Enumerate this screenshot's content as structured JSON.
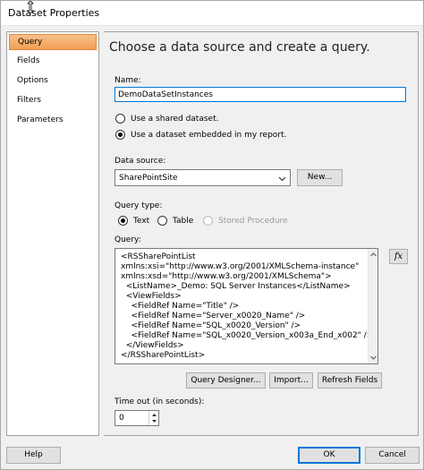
{
  "window": {
    "title": "Dataset Properties"
  },
  "sidebar": {
    "items": [
      {
        "label": "Query"
      },
      {
        "label": "Fields"
      },
      {
        "label": "Options"
      },
      {
        "label": "Filters"
      },
      {
        "label": "Parameters"
      }
    ],
    "selected": "Query"
  },
  "main": {
    "heading": "Choose a data source and create a query.",
    "name_label": "Name:",
    "name_value": "DemoDataSetInstances",
    "dataset_options": [
      {
        "label": "Use a shared dataset.",
        "checked": false
      },
      {
        "label": "Use a dataset embedded in my report.",
        "checked": true
      }
    ],
    "datasource_label": "Data source:",
    "datasource_value": "SharePointSite",
    "new_button": "New...",
    "query_type_label": "Query type:",
    "query_types": [
      {
        "label": "Text",
        "checked": true,
        "disabled": false
      },
      {
        "label": "Table",
        "checked": false,
        "disabled": false
      },
      {
        "label": "Stored Procedure",
        "checked": false,
        "disabled": true
      }
    ],
    "query_label": "Query:",
    "query_lines": [
      "<RSSharePointList",
      "xmlns:xsi=\"http://www.w3.org/2001/XMLSchema-instance\"",
      "xmlns:xsd=\"http://www.w3.org/2001/XMLSchema\">",
      "  <ListName>_Demo: SQL Server Instances</ListName>",
      "  <ViewFields>",
      "    <FieldRef Name=\"Title\" />",
      "    <FieldRef Name=\"Server_x0020_Name\" />",
      "    <FieldRef Name=\"SQL_x0020_Version\" />",
      "    <FieldRef Name=\"SQL_x0020_Version_x003a_End_x002\" />",
      "  </ViewFields>",
      "</RSSharePointList>"
    ],
    "fx_label": "fx",
    "query_designer_button": "Query Designer...",
    "import_button": "Import...",
    "refresh_fields_button": "Refresh Fields",
    "timeout_label": "Time out (in seconds):",
    "timeout_value": "0"
  },
  "footer": {
    "help_button": "Help",
    "ok_button": "OK",
    "cancel_button": "Cancel"
  }
}
